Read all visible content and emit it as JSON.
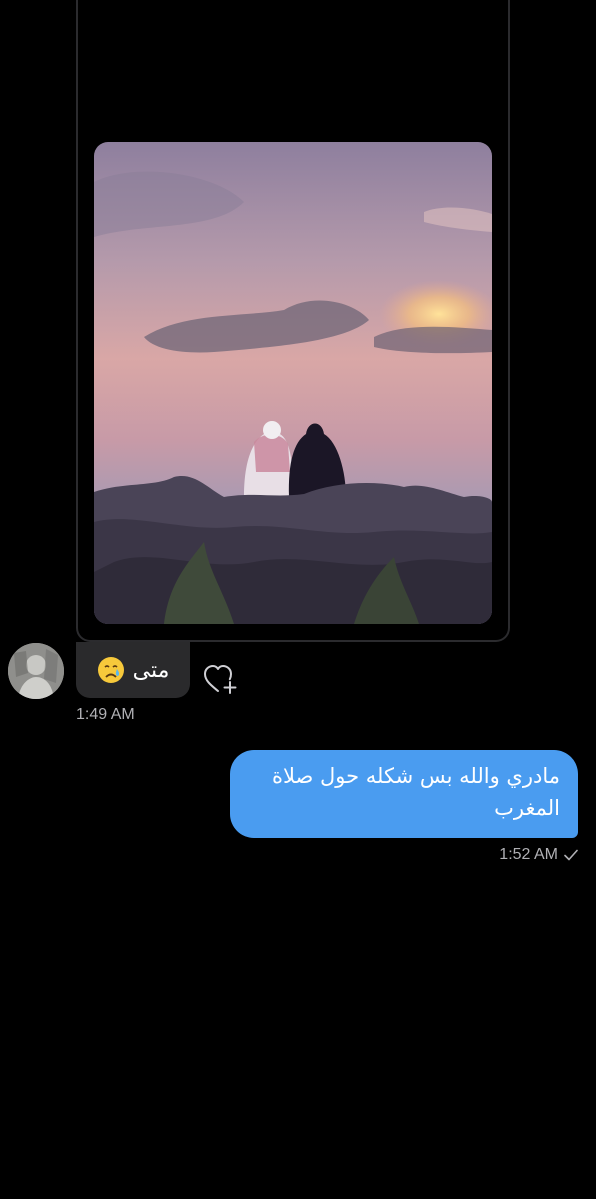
{
  "conversation": {
    "shared_media": {
      "image_alt_icon": "sunset-photo"
    },
    "received_message": {
      "text": "متى",
      "emoji_icon": "crying-face-emoji",
      "timestamp": "1:49 AM"
    },
    "reaction_button": {
      "icon": "heart-plus-icon"
    },
    "sent_message": {
      "text": "مادري والله بس شكله حول صلاة المغرب",
      "timestamp": "1:52 AM",
      "status_icon": "checkmark-icon"
    }
  },
  "colors": {
    "background": "#000000",
    "received_bubble": "#2a2a2c",
    "sent_bubble": "#4a9cf0",
    "timestamp": "#b0b0b4"
  }
}
